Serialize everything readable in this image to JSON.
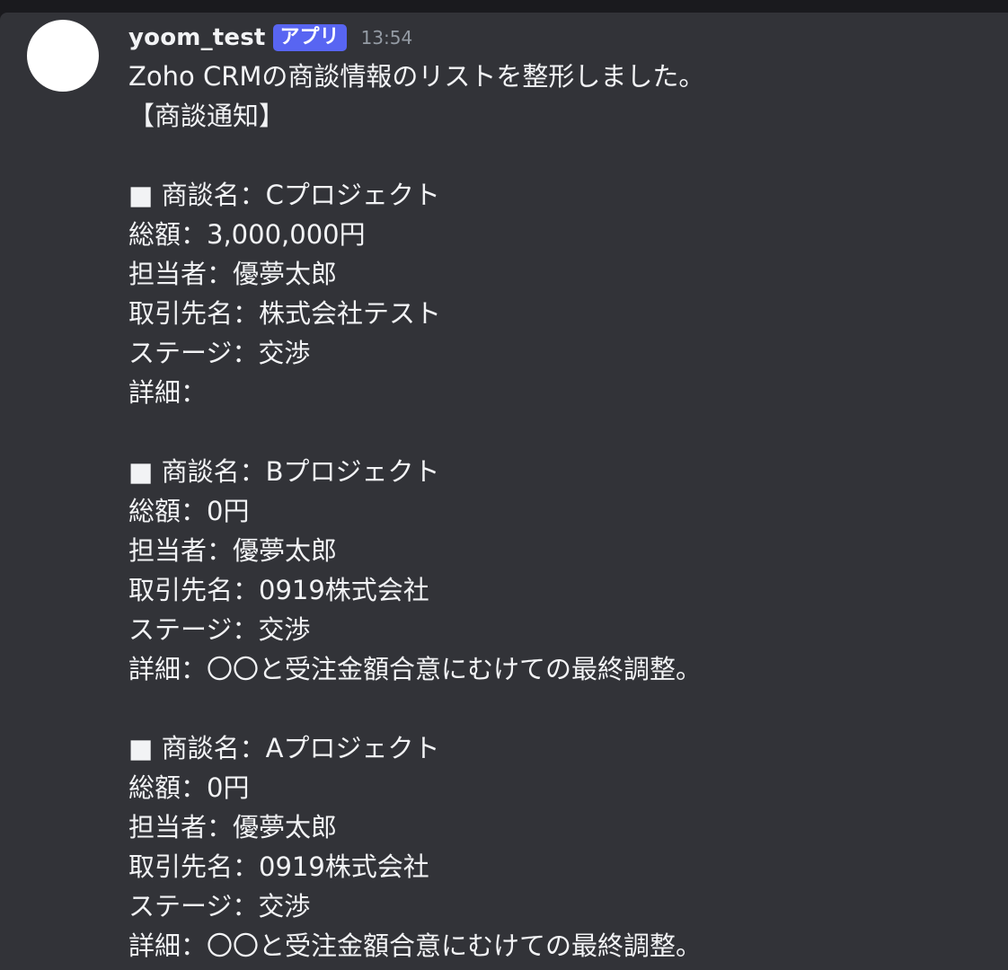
{
  "message": {
    "author": "yoom_test",
    "badge": "アプリ",
    "time": "13:54",
    "intro": "Zoho CRMの商談情報のリストを整形しました。",
    "heading": "【商談通知】",
    "deals": [
      {
        "name": "■ 商談名：Cプロジェクト",
        "amount": "総額：3,000,000円",
        "owner": "担当者：優夢太郎",
        "account": "取引先名：株式会社テスト",
        "stage": "ステージ：交渉",
        "detail": "詳細："
      },
      {
        "name": "■ 商談名：Bプロジェクト",
        "amount": "総額：0円",
        "owner": "担当者：優夢太郎",
        "account": "取引先名：0919株式会社",
        "stage": "ステージ：交渉",
        "detail": "詳細：〇〇と受注金額合意にむけての最終調整。"
      },
      {
        "name": "■ 商談名：Aプロジェクト",
        "amount": "総額：0円",
        "owner": "担当者：優夢太郎",
        "account": "取引先名：0919株式会社",
        "stage": "ステージ：交渉",
        "detail": "詳細：〇〇と受注金額合意にむけての最終調整。"
      }
    ]
  },
  "colors": {
    "background": "#323338",
    "badge": "#5865f2",
    "timestamp": "#949ba4",
    "text": "#f2f3f5"
  }
}
